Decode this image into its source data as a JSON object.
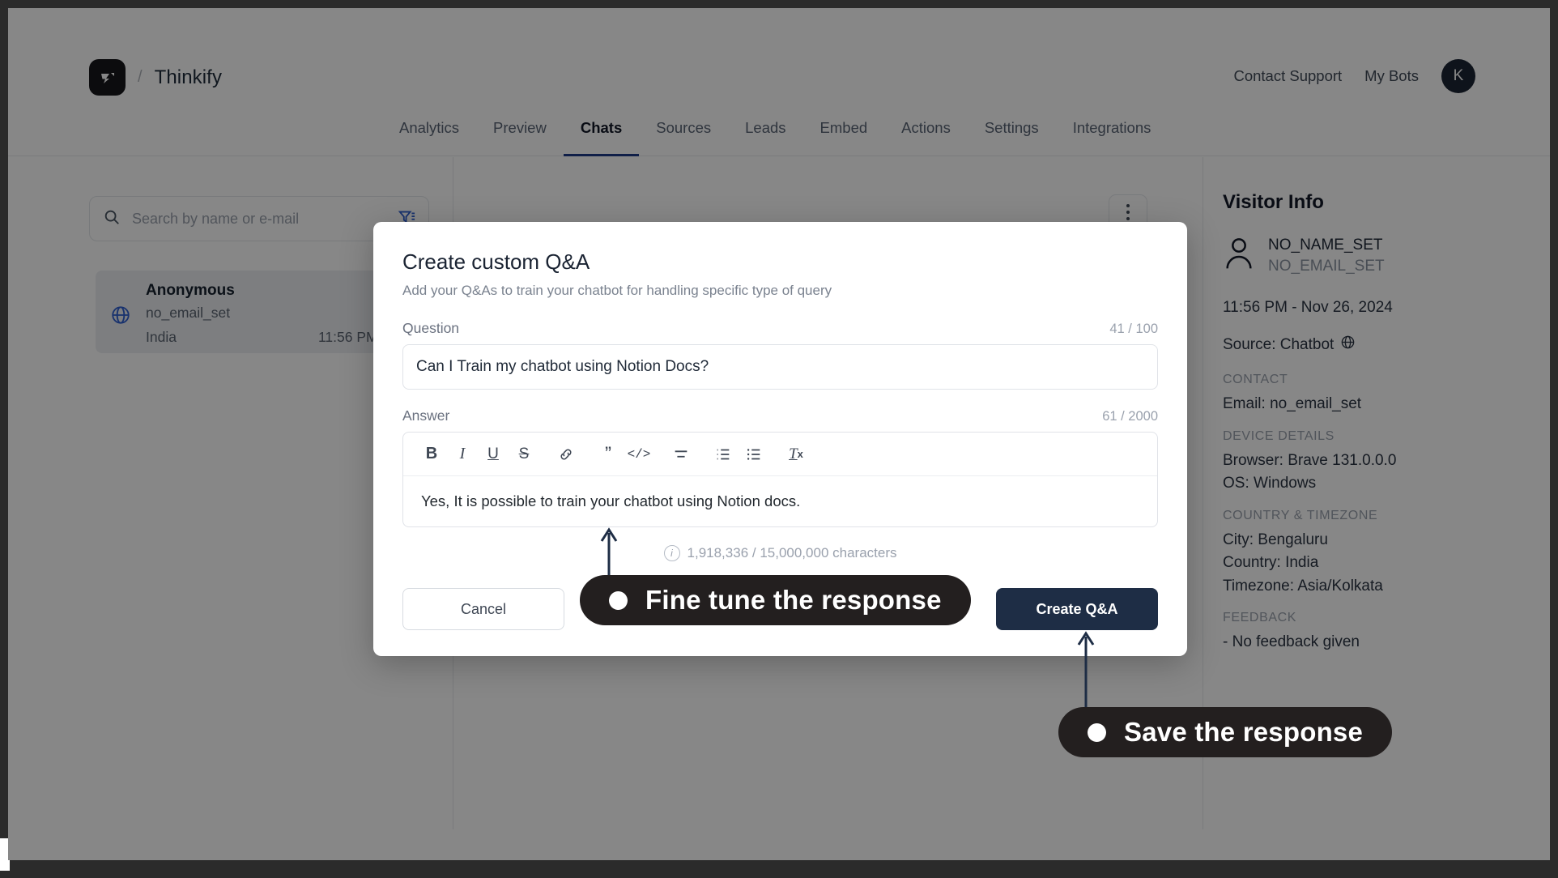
{
  "header": {
    "brand_name": "Thinkify",
    "separator": "/",
    "logo_icon": "thinkify-logo-icon",
    "links": [
      {
        "label": "Contact Support",
        "name": "contact-support-link"
      },
      {
        "label": "My Bots",
        "name": "my-bots-link"
      }
    ],
    "avatar_initial": "K"
  },
  "nav": {
    "tabs": [
      {
        "label": "Analytics",
        "active": false
      },
      {
        "label": "Preview",
        "active": false
      },
      {
        "label": "Chats",
        "active": true
      },
      {
        "label": "Sources",
        "active": false
      },
      {
        "label": "Leads",
        "active": false
      },
      {
        "label": "Embed",
        "active": false
      },
      {
        "label": "Actions",
        "active": false
      },
      {
        "label": "Settings",
        "active": false
      },
      {
        "label": "Integrations",
        "active": false
      }
    ],
    "active_accent": "#1f3c88"
  },
  "left_panel": {
    "search": {
      "placeholder": "Search by name or e-mail",
      "value": "",
      "search_icon": "search-icon",
      "filter_icon": "filter-icon",
      "filter_color": "#2f5fd0"
    },
    "chats": [
      {
        "name": "Anonymous",
        "email": "no_email_set",
        "country": "India",
        "time": "11:56 PM,",
        "channel_icon": "globe-icon"
      }
    ]
  },
  "center_panel": {
    "menu_icon": "kebab-menu-icon"
  },
  "right_panel": {
    "title": "Visitor Info",
    "visitor": {
      "name": "NO_NAME_SET",
      "email": "NO_EMAIL_SET",
      "avatar_icon": "person-icon"
    },
    "timestamp": "11:56 PM - Nov 26, 2024",
    "source_label": "Source: Chatbot",
    "source_icon": "globe-icon",
    "sections": [
      {
        "label": "CONTACT",
        "values": [
          "Email: no_email_set"
        ]
      },
      {
        "label": "DEVICE DETAILS",
        "values": [
          "Browser: Brave 131.0.0.0",
          "OS: Windows"
        ]
      },
      {
        "label": "COUNTRY & TIMEZONE",
        "values": [
          "City: Bengaluru",
          "Country: India",
          "Timezone: Asia/Kolkata"
        ]
      },
      {
        "label": "FEEDBACK",
        "values": [
          "-  No feedback given"
        ]
      }
    ]
  },
  "modal": {
    "title": "Create custom Q&A",
    "subtitle": "Add your Q&As to train your chatbot for handling specific type of query",
    "question": {
      "label": "Question",
      "counter": "41 / 100",
      "value": "Can I Train my chatbot using Notion Docs?",
      "placeholder": ""
    },
    "answer": {
      "label": "Answer",
      "counter": "61 / 2000",
      "value": "Yes, It is possible to train your chatbot using Notion docs.",
      "toolbar": [
        {
          "icon": "bold-icon",
          "glyph": "B"
        },
        {
          "icon": "italic-icon",
          "glyph": "I"
        },
        {
          "icon": "underline-icon",
          "glyph": "U"
        },
        {
          "icon": "strikethrough-icon",
          "glyph": "S"
        },
        {
          "icon": "link-icon",
          "glyph": "ὑ7"
        },
        {
          "icon": "blockquote-icon",
          "glyph": "”"
        },
        {
          "icon": "code-icon",
          "glyph": "</>"
        },
        {
          "icon": "align-icon",
          "glyph": "≡"
        },
        {
          "icon": "ordered-list-icon",
          "glyph": "1."
        },
        {
          "icon": "bullet-list-icon",
          "glyph": "•"
        },
        {
          "icon": "clear-format-icon",
          "glyph": "Tx"
        }
      ]
    },
    "char_note": "1,918,336 / 15,000,000 characters",
    "info_icon": "info-icon",
    "cancel_label": "Cancel",
    "create_label": "Create Q&A",
    "primary_color": "#1e2d45"
  },
  "callouts": [
    {
      "text": "Fine tune the response",
      "name": "callout-fine-tune"
    },
    {
      "text": "Save the response",
      "name": "callout-save-response"
    }
  ]
}
